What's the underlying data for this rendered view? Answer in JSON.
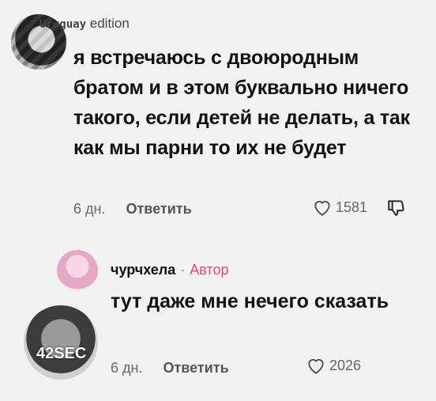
{
  "comment1": {
    "username_prefix": "Uruguay",
    "username_suffix": "edition",
    "text": "я встречаюсь с двоюродным братом и в этом буквально ничего такого, если детей не делать, а так как мы парни то их не будет",
    "time": "6 дн.",
    "reply_label": "Ответить",
    "likes": "1581"
  },
  "comment2": {
    "username": "чурчхела",
    "separator": "·",
    "author_label": "Автор",
    "text": "тут даже мне нечего сказать",
    "time": "6 дн.",
    "reply_label": "Ответить",
    "likes": "2026"
  },
  "avatar3": {
    "label": "42SEC"
  },
  "icons": {
    "like": "heart-icon",
    "dislike": "thumb-down-icon"
  },
  "colors": {
    "author": "#e24b6a",
    "text": "#111111",
    "meta": "#666666"
  }
}
